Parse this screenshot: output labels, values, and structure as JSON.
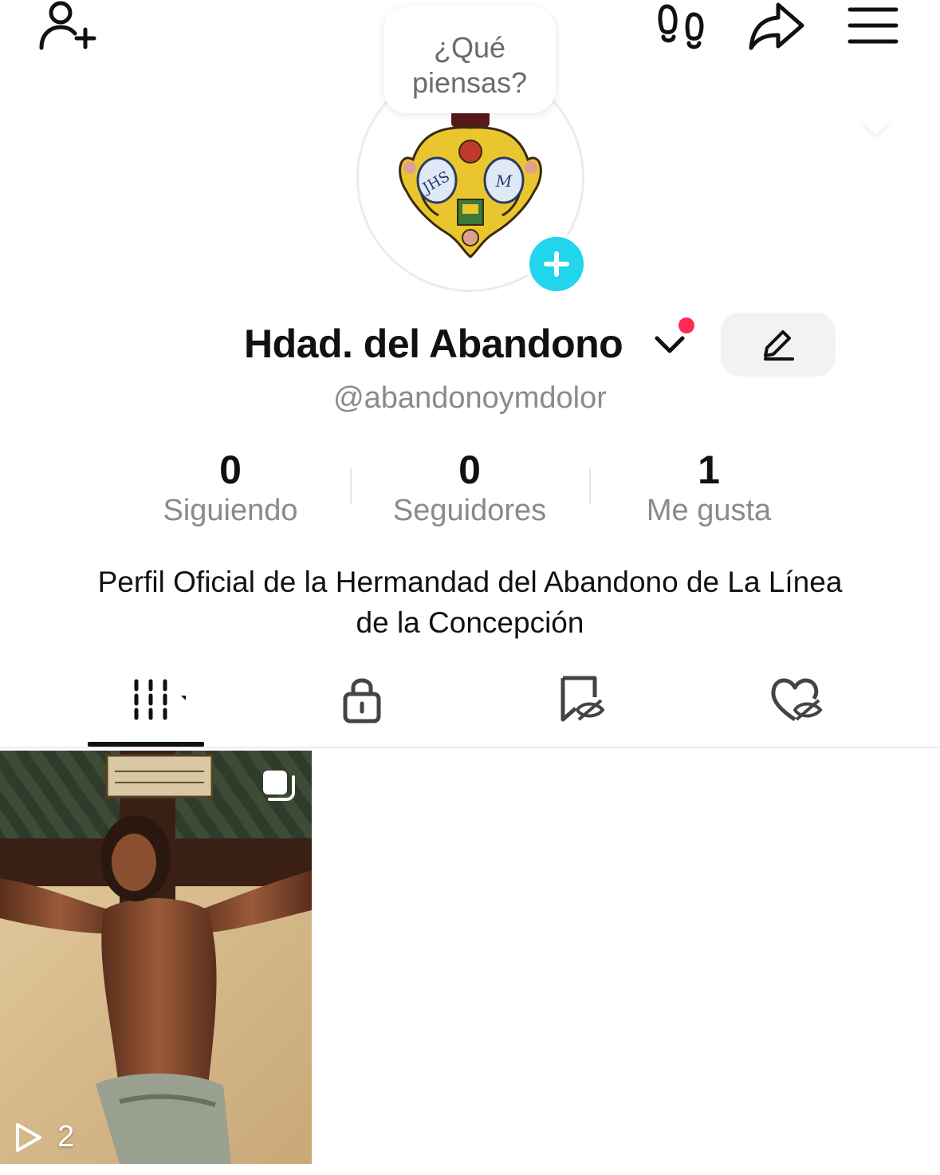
{
  "header": {
    "add_friend_icon": "person-plus-icon",
    "footprints_icon": "footprints-icon",
    "share_icon": "share-arrow-icon",
    "menu_icon": "hamburger-menu-icon"
  },
  "avatar": {
    "prompt_bubble": "¿Qué piensas?",
    "add_icon": "plus-icon"
  },
  "profile": {
    "display_name": "Hdad. del Abandono",
    "username": "@abandonoymdolor",
    "edit_icon": "pencil-icon",
    "bio": "Perfil Oficial de la Hermandad del Abandono de La Línea de la Concepción"
  },
  "stats": {
    "following": {
      "value": "0",
      "label": "Siguiendo"
    },
    "followers": {
      "value": "0",
      "label": "Seguidores"
    },
    "likes": {
      "value": "1",
      "label": "Me gusta"
    }
  },
  "tabs": [
    {
      "icon": "videos-grid-icon",
      "selected": true
    },
    {
      "icon": "lock-icon",
      "selected": false
    },
    {
      "icon": "reposts-hidden-icon",
      "selected": false
    },
    {
      "icon": "liked-hidden-icon",
      "selected": false
    }
  ],
  "videos": [
    {
      "play_count": "2",
      "multi_icon": "multi-photo-icon",
      "play_icon": "play-icon"
    }
  ],
  "colors": {
    "accent_cyan": "#20d5ec",
    "notification_red": "#fe2c55",
    "secondary_text": "#8a8a8a"
  }
}
